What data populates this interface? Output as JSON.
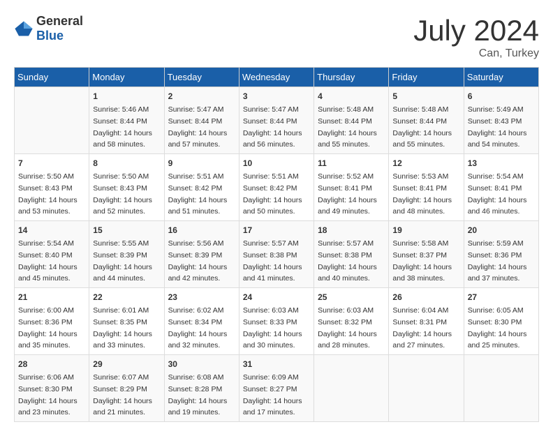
{
  "header": {
    "logo_general": "General",
    "logo_blue": "Blue",
    "month": "July 2024",
    "location": "Can, Turkey"
  },
  "days_of_week": [
    "Sunday",
    "Monday",
    "Tuesday",
    "Wednesday",
    "Thursday",
    "Friday",
    "Saturday"
  ],
  "weeks": [
    [
      {
        "day": "",
        "sunrise": "",
        "sunset": "",
        "daylight": ""
      },
      {
        "day": "1",
        "sunrise": "Sunrise: 5:46 AM",
        "sunset": "Sunset: 8:44 PM",
        "daylight": "Daylight: 14 hours and 58 minutes."
      },
      {
        "day": "2",
        "sunrise": "Sunrise: 5:47 AM",
        "sunset": "Sunset: 8:44 PM",
        "daylight": "Daylight: 14 hours and 57 minutes."
      },
      {
        "day": "3",
        "sunrise": "Sunrise: 5:47 AM",
        "sunset": "Sunset: 8:44 PM",
        "daylight": "Daylight: 14 hours and 56 minutes."
      },
      {
        "day": "4",
        "sunrise": "Sunrise: 5:48 AM",
        "sunset": "Sunset: 8:44 PM",
        "daylight": "Daylight: 14 hours and 55 minutes."
      },
      {
        "day": "5",
        "sunrise": "Sunrise: 5:48 AM",
        "sunset": "Sunset: 8:44 PM",
        "daylight": "Daylight: 14 hours and 55 minutes."
      },
      {
        "day": "6",
        "sunrise": "Sunrise: 5:49 AM",
        "sunset": "Sunset: 8:43 PM",
        "daylight": "Daylight: 14 hours and 54 minutes."
      }
    ],
    [
      {
        "day": "7",
        "sunrise": "Sunrise: 5:50 AM",
        "sunset": "Sunset: 8:43 PM",
        "daylight": "Daylight: 14 hours and 53 minutes."
      },
      {
        "day": "8",
        "sunrise": "Sunrise: 5:50 AM",
        "sunset": "Sunset: 8:43 PM",
        "daylight": "Daylight: 14 hours and 52 minutes."
      },
      {
        "day": "9",
        "sunrise": "Sunrise: 5:51 AM",
        "sunset": "Sunset: 8:42 PM",
        "daylight": "Daylight: 14 hours and 51 minutes."
      },
      {
        "day": "10",
        "sunrise": "Sunrise: 5:51 AM",
        "sunset": "Sunset: 8:42 PM",
        "daylight": "Daylight: 14 hours and 50 minutes."
      },
      {
        "day": "11",
        "sunrise": "Sunrise: 5:52 AM",
        "sunset": "Sunset: 8:41 PM",
        "daylight": "Daylight: 14 hours and 49 minutes."
      },
      {
        "day": "12",
        "sunrise": "Sunrise: 5:53 AM",
        "sunset": "Sunset: 8:41 PM",
        "daylight": "Daylight: 14 hours and 48 minutes."
      },
      {
        "day": "13",
        "sunrise": "Sunrise: 5:54 AM",
        "sunset": "Sunset: 8:41 PM",
        "daylight": "Daylight: 14 hours and 46 minutes."
      }
    ],
    [
      {
        "day": "14",
        "sunrise": "Sunrise: 5:54 AM",
        "sunset": "Sunset: 8:40 PM",
        "daylight": "Daylight: 14 hours and 45 minutes."
      },
      {
        "day": "15",
        "sunrise": "Sunrise: 5:55 AM",
        "sunset": "Sunset: 8:39 PM",
        "daylight": "Daylight: 14 hours and 44 minutes."
      },
      {
        "day": "16",
        "sunrise": "Sunrise: 5:56 AM",
        "sunset": "Sunset: 8:39 PM",
        "daylight": "Daylight: 14 hours and 42 minutes."
      },
      {
        "day": "17",
        "sunrise": "Sunrise: 5:57 AM",
        "sunset": "Sunset: 8:38 PM",
        "daylight": "Daylight: 14 hours and 41 minutes."
      },
      {
        "day": "18",
        "sunrise": "Sunrise: 5:57 AM",
        "sunset": "Sunset: 8:38 PM",
        "daylight": "Daylight: 14 hours and 40 minutes."
      },
      {
        "day": "19",
        "sunrise": "Sunrise: 5:58 AM",
        "sunset": "Sunset: 8:37 PM",
        "daylight": "Daylight: 14 hours and 38 minutes."
      },
      {
        "day": "20",
        "sunrise": "Sunrise: 5:59 AM",
        "sunset": "Sunset: 8:36 PM",
        "daylight": "Daylight: 14 hours and 37 minutes."
      }
    ],
    [
      {
        "day": "21",
        "sunrise": "Sunrise: 6:00 AM",
        "sunset": "Sunset: 8:36 PM",
        "daylight": "Daylight: 14 hours and 35 minutes."
      },
      {
        "day": "22",
        "sunrise": "Sunrise: 6:01 AM",
        "sunset": "Sunset: 8:35 PM",
        "daylight": "Daylight: 14 hours and 33 minutes."
      },
      {
        "day": "23",
        "sunrise": "Sunrise: 6:02 AM",
        "sunset": "Sunset: 8:34 PM",
        "daylight": "Daylight: 14 hours and 32 minutes."
      },
      {
        "day": "24",
        "sunrise": "Sunrise: 6:03 AM",
        "sunset": "Sunset: 8:33 PM",
        "daylight": "Daylight: 14 hours and 30 minutes."
      },
      {
        "day": "25",
        "sunrise": "Sunrise: 6:03 AM",
        "sunset": "Sunset: 8:32 PM",
        "daylight": "Daylight: 14 hours and 28 minutes."
      },
      {
        "day": "26",
        "sunrise": "Sunrise: 6:04 AM",
        "sunset": "Sunset: 8:31 PM",
        "daylight": "Daylight: 14 hours and 27 minutes."
      },
      {
        "day": "27",
        "sunrise": "Sunrise: 6:05 AM",
        "sunset": "Sunset: 8:30 PM",
        "daylight": "Daylight: 14 hours and 25 minutes."
      }
    ],
    [
      {
        "day": "28",
        "sunrise": "Sunrise: 6:06 AM",
        "sunset": "Sunset: 8:30 PM",
        "daylight": "Daylight: 14 hours and 23 minutes."
      },
      {
        "day": "29",
        "sunrise": "Sunrise: 6:07 AM",
        "sunset": "Sunset: 8:29 PM",
        "daylight": "Daylight: 14 hours and 21 minutes."
      },
      {
        "day": "30",
        "sunrise": "Sunrise: 6:08 AM",
        "sunset": "Sunset: 8:28 PM",
        "daylight": "Daylight: 14 hours and 19 minutes."
      },
      {
        "day": "31",
        "sunrise": "Sunrise: 6:09 AM",
        "sunset": "Sunset: 8:27 PM",
        "daylight": "Daylight: 14 hours and 17 minutes."
      },
      {
        "day": "",
        "sunrise": "",
        "sunset": "",
        "daylight": ""
      },
      {
        "day": "",
        "sunrise": "",
        "sunset": "",
        "daylight": ""
      },
      {
        "day": "",
        "sunrise": "",
        "sunset": "",
        "daylight": ""
      }
    ]
  ]
}
